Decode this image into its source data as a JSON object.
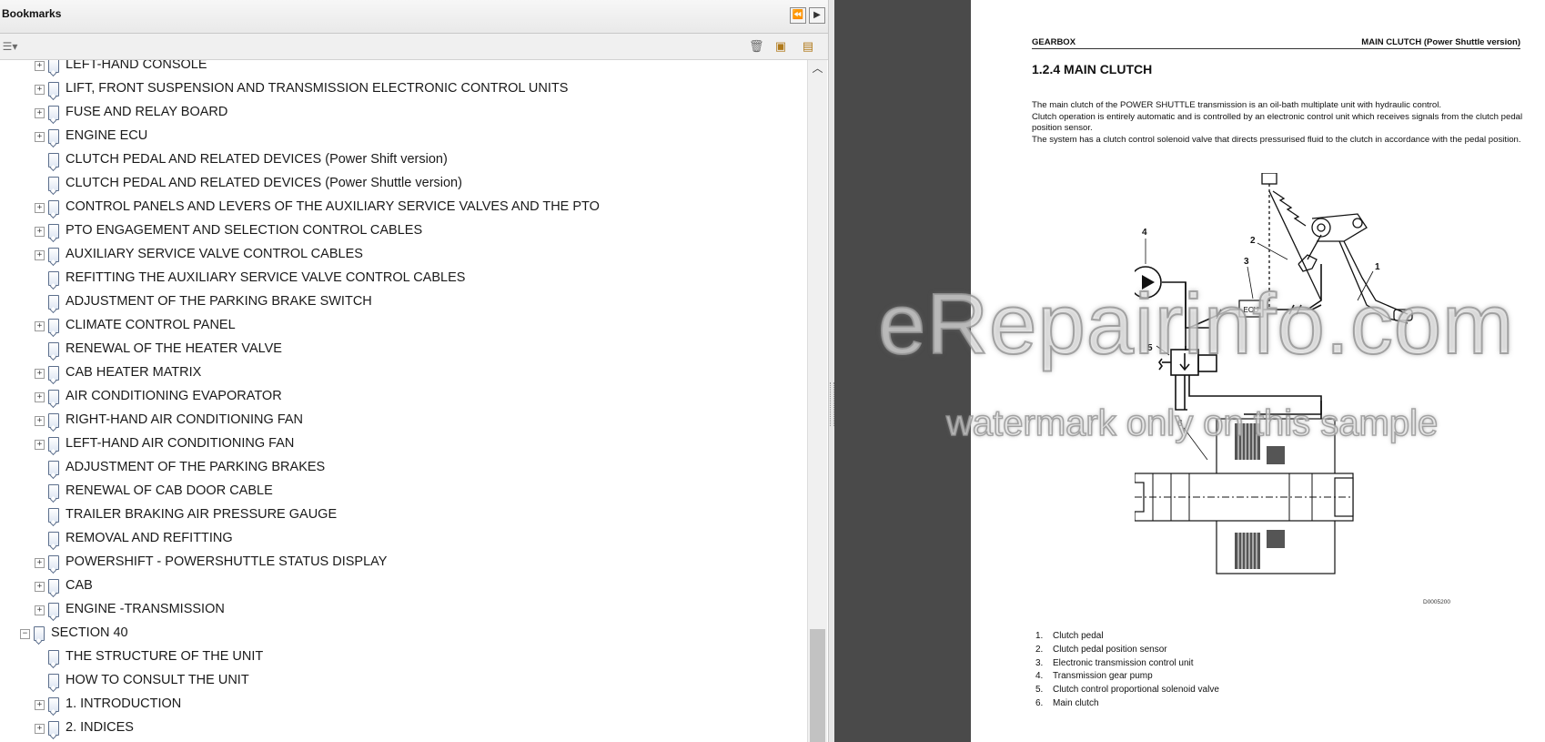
{
  "bookmarks_panel": {
    "title": "Bookmarks",
    "header_buttons": {
      "collapse": "⏪",
      "next": "▶"
    },
    "toolbar": {
      "options_icon": "options-menu-icon",
      "delete_icon": "trash-icon",
      "new_icon": "new-bookmark-icon",
      "expand_icon": "expand-bookmark-icon"
    },
    "items": [
      {
        "label": "LEFT-HAND CONSOLE",
        "suffix": "",
        "level": 2,
        "expandable": true,
        "expander": "+"
      },
      {
        "label": "LIFT, FRONT SUSPENSION AND TRANSMISSION ELECTRONIC CONTROL UNITS",
        "suffix": "",
        "level": 2,
        "expandable": true,
        "expander": "+"
      },
      {
        "label": "FUSE AND RELAY BOARD",
        "suffix": "",
        "level": 2,
        "expandable": true,
        "expander": "+"
      },
      {
        "label": "ENGINE ECU",
        "suffix": "",
        "level": 2,
        "expandable": true,
        "expander": "+"
      },
      {
        "label": "CLUTCH PEDAL AND RELATED DEVICES",
        "suffix": " (Power Shift version)",
        "level": 2,
        "expandable": false,
        "expander": ""
      },
      {
        "label": "CLUTCH PEDAL AND RELATED DEVICES",
        "suffix": " (Power Shuttle version)",
        "level": 2,
        "expandable": false,
        "expander": ""
      },
      {
        "label": "CONTROL PANELS AND LEVERS OF THE AUXILIARY SERVICE VALVES AND THE PTO",
        "suffix": "",
        "level": 2,
        "expandable": true,
        "expander": "+"
      },
      {
        "label": "PTO ENGAGEMENT AND SELECTION CONTROL CABLES",
        "suffix": "",
        "level": 2,
        "expandable": true,
        "expander": "+"
      },
      {
        "label": "AUXILIARY SERVICE VALVE CONTROL CABLES",
        "suffix": "",
        "level": 2,
        "expandable": true,
        "expander": "+"
      },
      {
        "label": "REFITTING THE AUXILIARY SERVICE VALVE CONTROL CABLES",
        "suffix": "",
        "level": 2,
        "expandable": false,
        "expander": ""
      },
      {
        "label": "ADJUSTMENT OF THE PARKING BRAKE SWITCH",
        "suffix": "",
        "level": 2,
        "expandable": false,
        "expander": ""
      },
      {
        "label": "CLIMATE CONTROL PANEL",
        "suffix": "",
        "level": 2,
        "expandable": true,
        "expander": "+"
      },
      {
        "label": "RENEWAL OF THE HEATER VALVE",
        "suffix": "",
        "level": 2,
        "expandable": false,
        "expander": ""
      },
      {
        "label": "CAB HEATER MATRIX",
        "suffix": "",
        "level": 2,
        "expandable": true,
        "expander": "+"
      },
      {
        "label": "AIR CONDITIONING EVAPORATOR",
        "suffix": "",
        "level": 2,
        "expandable": true,
        "expander": "+"
      },
      {
        "label": "RIGHT-HAND AIR CONDITIONING FAN",
        "suffix": "",
        "level": 2,
        "expandable": true,
        "expander": "+"
      },
      {
        "label": "LEFT-HAND AIR CONDITIONING FAN",
        "suffix": "",
        "level": 2,
        "expandable": true,
        "expander": "+"
      },
      {
        "label": "ADJUSTMENT OF THE PARKING BRAKES",
        "suffix": "",
        "level": 2,
        "expandable": false,
        "expander": ""
      },
      {
        "label": "RENEWAL OF CAB DOOR CABLE",
        "suffix": "",
        "level": 2,
        "expandable": false,
        "expander": ""
      },
      {
        "label": "TRAILER BRAKING AIR PRESSURE GAUGE",
        "suffix": "",
        "level": 2,
        "expandable": false,
        "expander": ""
      },
      {
        "label": "REMOVAL AND REFITTING",
        "suffix": "",
        "level": 2,
        "expandable": false,
        "expander": ""
      },
      {
        "label": "POWERSHIFT - POWERSHUTTLE STATUS DISPLAY",
        "suffix": "",
        "level": 2,
        "expandable": true,
        "expander": "+"
      },
      {
        "label": "CAB",
        "suffix": "",
        "level": 2,
        "expandable": true,
        "expander": "+"
      },
      {
        "label": "ENGINE -TRANSMISSION",
        "suffix": "",
        "level": 2,
        "expandable": true,
        "expander": "+"
      },
      {
        "label": "SECTION 40",
        "suffix": "",
        "level": 1,
        "expandable": true,
        "expander": "−"
      },
      {
        "label": "THE STRUCTURE OF THE UNIT",
        "suffix": "",
        "level": 2,
        "expandable": false,
        "expander": ""
      },
      {
        "label": "HOW TO CONSULT THE UNIT",
        "suffix": "",
        "level": 2,
        "expandable": false,
        "expander": ""
      },
      {
        "label": "1. INTRODUCTION",
        "suffix": "",
        "level": 2,
        "expandable": true,
        "expander": "+"
      },
      {
        "label": "2. INDICES",
        "suffix": "",
        "level": 2,
        "expandable": true,
        "expander": "+"
      }
    ],
    "scrollbar": {
      "up_arrow": "^",
      "position_fraction": 0.83
    }
  },
  "document": {
    "header_left": "GEARBOX",
    "header_right": "MAIN CLUTCH (Power Shuttle version)",
    "section_title": "1.2.4 MAIN CLUTCH",
    "paragraphs": [
      "The main clutch of the POWER SHUTTLE transmission is an oil-bath multiplate unit with hydraulic control.",
      "Clutch operation is entirely automatic and is controlled by an electronic control unit which receives signals from the clutch pedal position sensor.",
      "The system has a clutch control solenoid valve that directs pressurised fluid to the clutch in accordance with the pedal position."
    ],
    "diagram_labels": {
      "n1": "1",
      "n2": "2",
      "n3": "3",
      "n4": "4",
      "n5": "5",
      "n6": "6",
      "ecu": "ECU"
    },
    "figure_code": "D0005200",
    "legend": [
      {
        "num": "1.",
        "text": "Clutch pedal"
      },
      {
        "num": "2.",
        "text": "Clutch pedal position sensor"
      },
      {
        "num": "3.",
        "text": "Electronic transmission control unit"
      },
      {
        "num": "4.",
        "text": "Transmission gear pump"
      },
      {
        "num": "5.",
        "text": "Clutch control proportional solenoid valve"
      },
      {
        "num": "6.",
        "text": "Main clutch"
      }
    ]
  },
  "watermark": {
    "line1": "eRepairinfo.com",
    "line2": "watermark only on this sample"
  },
  "colors": {
    "viewer_gray": "#4a4a4a",
    "panel_bg": "#ffffff",
    "bookmark_icon": "#5b6e8c"
  }
}
